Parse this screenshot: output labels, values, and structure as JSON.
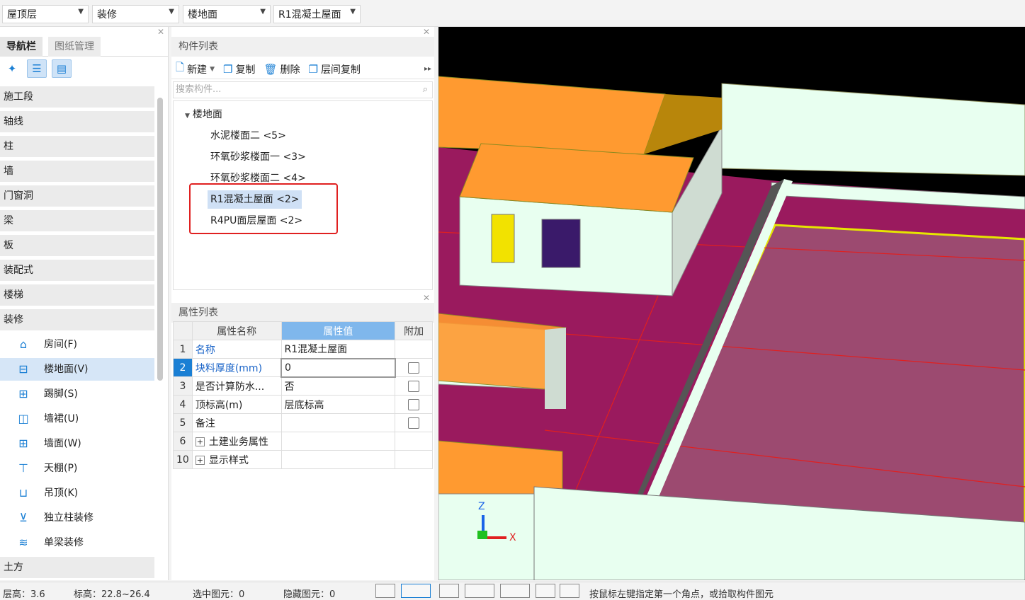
{
  "topbar": {
    "floor": "屋顶层",
    "category": "装修",
    "component_type": "楼地面",
    "component": "R1混凝土屋面"
  },
  "nav": {
    "tabs": [
      "导航栏",
      "图纸管理"
    ],
    "categories": [
      "施工段",
      "轴线",
      "柱",
      "墙",
      "门窗洞",
      "梁",
      "板",
      "装配式",
      "楼梯",
      "装修"
    ],
    "sub_items": [
      "房间(F)",
      "楼地面(V)",
      "踢脚(S)",
      "墙裙(U)",
      "墙面(W)",
      "天棚(P)",
      "吊顶(K)",
      "独立柱装修",
      "单梁装修"
    ],
    "bottom_category": "土方"
  },
  "components": {
    "title": "构件列表",
    "toolbar": {
      "new": "新建",
      "copy": "复制",
      "delete": "删除",
      "floor_copy": "层间复制"
    },
    "search_placeholder": "搜索构件...",
    "root": "楼地面",
    "items": [
      "水泥楼面二 <5>",
      "环氧砂浆楼面一 <3>",
      "环氧砂浆楼面二 <4>",
      "R1混凝土屋面 <2>",
      "R4PU面层屋面 <2>"
    ]
  },
  "properties": {
    "title": "属性列表",
    "headers": [
      "属性名称",
      "属性值",
      "附加"
    ],
    "rows": [
      {
        "num": "1",
        "name": "名称",
        "value": "R1混凝土屋面"
      },
      {
        "num": "2",
        "name": "块料厚度(mm)",
        "value": "0"
      },
      {
        "num": "3",
        "name": "是否计算防水...",
        "value": "否"
      },
      {
        "num": "4",
        "name": "顶标高(m)",
        "value": "层底标高"
      },
      {
        "num": "5",
        "name": "备注",
        "value": ""
      },
      {
        "num": "6",
        "name": "土建业务属性",
        "value": ""
      },
      {
        "num": "10",
        "name": "显示样式",
        "value": ""
      }
    ]
  },
  "viewport": {
    "axis_x": "X",
    "axis_z": "Z"
  },
  "status": {
    "floor_height": "层高：3.6",
    "elevation": "标高：22.8~26.4",
    "selected": "选中图元：0",
    "hidden": "隐藏图元：0",
    "hint": "按鼠标左键指定第一个角点，或拾取构件图元"
  },
  "colors": {
    "accent": "#1a7fd4",
    "slab": "#9a1a5e",
    "wall": "#e8fff0",
    "wall_top": "#ff9a30",
    "highlight_red": "#e02020"
  }
}
